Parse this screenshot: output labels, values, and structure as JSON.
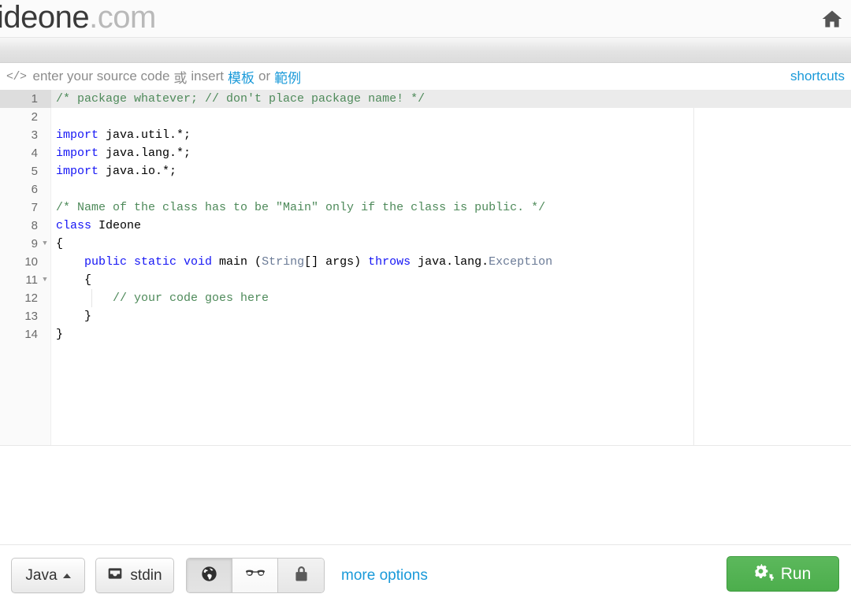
{
  "header": {
    "logo_name": "ideone",
    "logo_tld": ".com",
    "home_icon": "home-icon"
  },
  "editor_toolbar": {
    "code_glyph": "</>",
    "prompt_prefix": "enter your source code",
    "lang_or": "或",
    "insert_word": "insert",
    "template_link": "模板",
    "or_word": "or",
    "sample_link": "範例",
    "shortcuts_label": "shortcuts"
  },
  "editor": {
    "active_line": 1,
    "line_numbers": [
      1,
      2,
      3,
      4,
      5,
      6,
      7,
      8,
      9,
      10,
      11,
      12,
      13,
      14
    ],
    "fold_lines": [
      9,
      11
    ],
    "lines": [
      {
        "n": 1,
        "tokens": [
          {
            "t": "/* package whatever; // don't place package name! */",
            "c": "com"
          }
        ]
      },
      {
        "n": 2,
        "tokens": []
      },
      {
        "n": 3,
        "tokens": [
          {
            "t": "import",
            "c": "kw"
          },
          {
            "t": " java.util.*;",
            "c": "pln"
          }
        ]
      },
      {
        "n": 4,
        "tokens": [
          {
            "t": "import",
            "c": "kw"
          },
          {
            "t": " java.lang.*;",
            "c": "pln"
          }
        ]
      },
      {
        "n": 5,
        "tokens": [
          {
            "t": "import",
            "c": "kw"
          },
          {
            "t": " java.io.*;",
            "c": "pln"
          }
        ]
      },
      {
        "n": 6,
        "tokens": []
      },
      {
        "n": 7,
        "tokens": [
          {
            "t": "/* Name of the class has to be \"Main\" only if the class is public. */",
            "c": "com"
          }
        ]
      },
      {
        "n": 8,
        "tokens": [
          {
            "t": "class",
            "c": "kw"
          },
          {
            "t": " Ideone",
            "c": "pln"
          }
        ]
      },
      {
        "n": 9,
        "tokens": [
          {
            "t": "{",
            "c": "pln"
          }
        ]
      },
      {
        "n": 10,
        "tokens": [
          {
            "t": "    ",
            "c": "pln"
          },
          {
            "t": "public static void",
            "c": "kw"
          },
          {
            "t": " main (",
            "c": "pln"
          },
          {
            "t": "String",
            "c": "typ"
          },
          {
            "t": "[] args) ",
            "c": "pln"
          },
          {
            "t": "throws",
            "c": "kw"
          },
          {
            "t": " java.lang.",
            "c": "pln"
          },
          {
            "t": "Exception",
            "c": "typ"
          }
        ]
      },
      {
        "n": 11,
        "tokens": [
          {
            "t": "    {",
            "c": "pln"
          }
        ]
      },
      {
        "n": 12,
        "tokens": [
          {
            "t": "        // your code goes here",
            "c": "com"
          }
        ]
      },
      {
        "n": 13,
        "tokens": [
          {
            "t": "    }",
            "c": "pln"
          }
        ]
      },
      {
        "n": 14,
        "tokens": [
          {
            "t": "}",
            "c": "pln"
          }
        ]
      }
    ]
  },
  "bottom_bar": {
    "language_label": "Java",
    "language_caret": "caret-up-icon",
    "stdin_label": "stdin",
    "stdin_icon": "inbox-icon",
    "visibility": {
      "public_icon": "globe-icon",
      "secret_icon": "glasses-icon",
      "private_icon": "lock-icon",
      "selected": "globe-icon"
    },
    "more_options_label": "more options",
    "run_label": "Run",
    "run_icon": "gears-icon"
  },
  "colors": {
    "link": "#1a9ad9",
    "run_green": "#5cb85c",
    "comment_green": "#4e8a5a",
    "keyword_blue": "#1515f5",
    "type_slate": "#6a7a96"
  }
}
